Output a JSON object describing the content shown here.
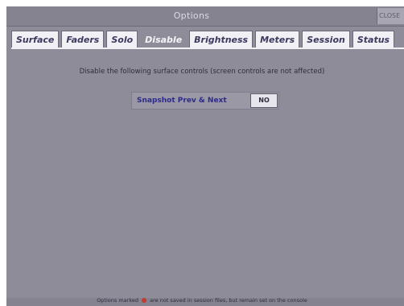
{
  "window": {
    "title": "Options",
    "close_label": "CLOSE"
  },
  "tabs": [
    {
      "label": "Surface",
      "active": false
    },
    {
      "label": "Faders",
      "active": false
    },
    {
      "label": "Solo",
      "active": false
    },
    {
      "label": "Disable",
      "active": true
    },
    {
      "label": "Brightness",
      "active": false
    },
    {
      "label": "Meters",
      "active": false
    },
    {
      "label": "Session",
      "active": false
    },
    {
      "label": "Status",
      "active": false
    }
  ],
  "disable": {
    "description": "Disable the following surface controls (screen controls are not affected)",
    "control_label": "Snapshot Prev & Next",
    "toggle_value": "NO"
  },
  "footer": {
    "text_before_marker": "Options marked",
    "text_after_marker": "are not saved in session files, but remain set on the console",
    "marker_color": "#c43b2f"
  },
  "colors": {
    "background": "#8e8c98",
    "tab_bg": "#f1f0f4",
    "tab_text": "#3b3960",
    "control_label": "#2c2a8a"
  }
}
